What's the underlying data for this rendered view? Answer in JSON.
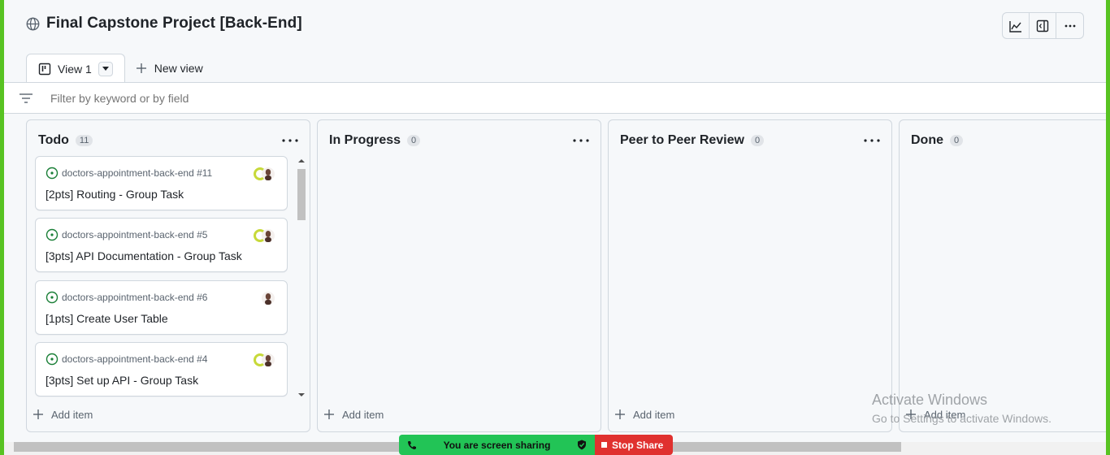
{
  "header": {
    "title": "Final Capstone Project [Back-End]",
    "toolbar": [
      {
        "icon": "insights-graph-icon"
      },
      {
        "icon": "sidebar-panel-icon"
      },
      {
        "icon": "kebab-menu-icon"
      }
    ]
  },
  "tabs": {
    "active": "View 1",
    "new_view": "New view"
  },
  "filter": {
    "placeholder": "Filter by keyword or by field"
  },
  "columns": [
    {
      "name": "Todo",
      "count": "11",
      "cards": [
        {
          "repo": "doctors-appointment-back-end #11",
          "title": "[2pts] Routing - Group Task"
        },
        {
          "repo": "doctors-appointment-back-end #5",
          "title": "[3pts] API Documentation - Group Task"
        },
        {
          "repo": "doctors-appointment-back-end #6",
          "title": "[1pts] Create User Table"
        },
        {
          "repo": "doctors-appointment-back-end #4",
          "title": "[3pts] Set up API - Group Task"
        }
      ],
      "add_item": "Add item"
    },
    {
      "name": "In Progress",
      "count": "0",
      "add_item": "Add item"
    },
    {
      "name": "Peer to Peer Review",
      "count": "0",
      "add_item": "Add item"
    },
    {
      "name": "Done",
      "count": "0",
      "add_item": "Add item"
    }
  ],
  "screen_share": {
    "status": "You are screen sharing",
    "stop": "Stop Share"
  },
  "watermark": {
    "line1": "Activate Windows",
    "line2": "Go to Settings to activate Windows."
  },
  "colors": {
    "accent_border": "#58c322",
    "open_issue": "#1a7f37",
    "share_green": "#22c456",
    "share_red": "#e0312f"
  }
}
